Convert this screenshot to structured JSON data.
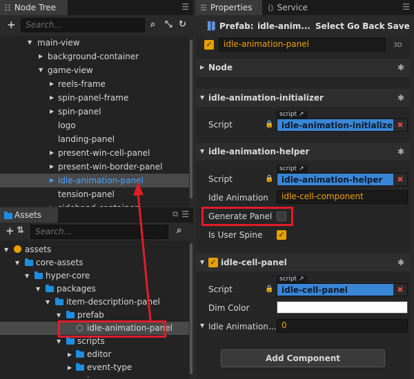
{
  "node_tree": {
    "tab_label": "Node Tree",
    "search_placeholder": "Search...",
    "rows": [
      {
        "label": "main-view"
      },
      {
        "label": "background-container"
      },
      {
        "label": "game-view"
      },
      {
        "label": "reels-frame"
      },
      {
        "label": "spin-panel-frame"
      },
      {
        "label": "spin-panel"
      },
      {
        "label": "logo"
      },
      {
        "label": "landing-panel"
      },
      {
        "label": "present-win-cell-panel"
      },
      {
        "label": "present-win-border-panel"
      },
      {
        "label": "idle-animation-panel"
      },
      {
        "label": "tension-panel"
      },
      {
        "label": "sideband-container"
      }
    ]
  },
  "assets": {
    "tab_label": "Assets",
    "search_placeholder": "Search...",
    "rows": [
      {
        "label": "assets"
      },
      {
        "label": "core-assets"
      },
      {
        "label": "hyper-core"
      },
      {
        "label": "packages"
      },
      {
        "label": "item-description-panel"
      },
      {
        "label": "prefab"
      },
      {
        "label": "idle-animation-panel"
      },
      {
        "label": "scripts"
      },
      {
        "label": "editor"
      },
      {
        "label": "event-type"
      },
      {
        "label": "i"
      }
    ]
  },
  "properties": {
    "tab_label": "Properties",
    "service_tab_label": "Service",
    "prefab_label": "Prefab:",
    "prefab_name": "idle-anim...",
    "select_label": "Select",
    "goback_label": "Go Back",
    "save_label": "Save",
    "node_name": "idle-animation-panel",
    "badge_3d": "3D",
    "node_section": "Node",
    "comp1": {
      "title": "idle-animation-initializer",
      "script_label": "Script",
      "script_tag": "script",
      "script_value": "idle-animation-initializer"
    },
    "comp2": {
      "title": "idle-animation-helper",
      "script_label": "Script",
      "script_tag": "script",
      "script_value": "idle-animation-helper",
      "idle_label": "Idle Animation",
      "idle_value": "idle-cell-component",
      "gen_label": "Generate Panel",
      "spine_label": "Is User Spine"
    },
    "comp3": {
      "title": "idle-cell-panel",
      "script_label": "Script",
      "script_tag": "script",
      "script_value": "idle-cell-panel",
      "dim_label": "Dim Color",
      "idle_label": "Idle Animation...",
      "idle_value": "0"
    },
    "add_component": "Add Component"
  }
}
